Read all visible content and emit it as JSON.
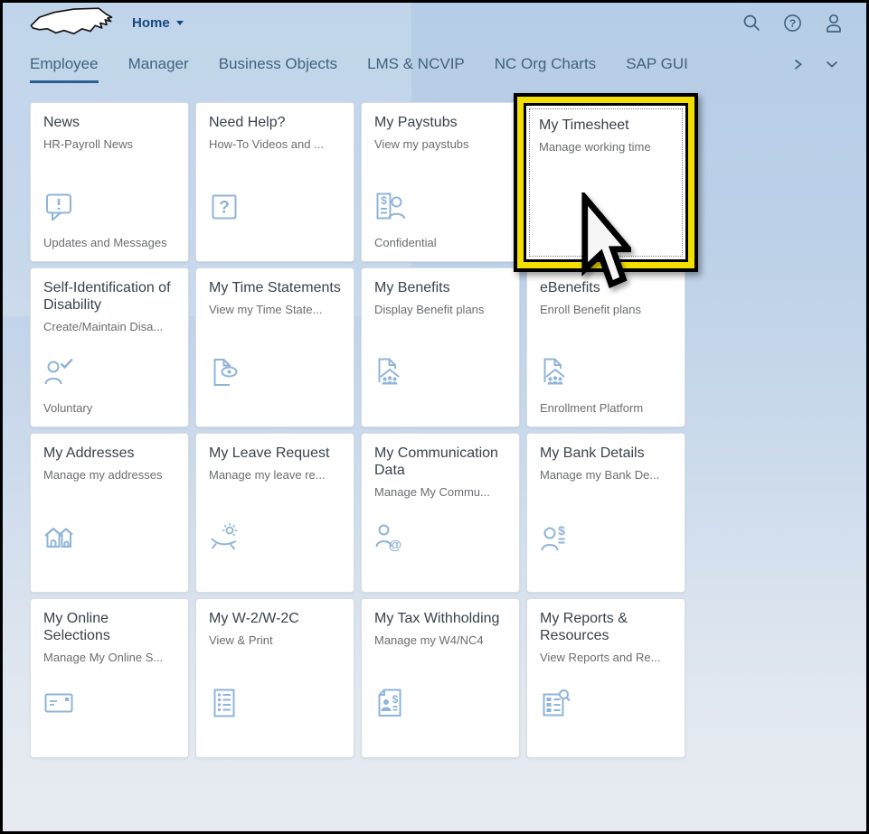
{
  "header": {
    "home_label": "Home",
    "logo": "north-carolina-state-outline",
    "icon_names": [
      "search-icon",
      "help-icon",
      "user-icon"
    ]
  },
  "tabs": [
    {
      "label": "Employee",
      "selected": true
    },
    {
      "label": "Manager",
      "selected": false
    },
    {
      "label": "Business Objects",
      "selected": false
    },
    {
      "label": "LMS & NCVIP",
      "selected": false
    },
    {
      "label": "NC Org Charts",
      "selected": false
    },
    {
      "label": "SAP GUI",
      "selected": false
    }
  ],
  "tiles": [
    {
      "title": "News",
      "subtitle": "HR-Payroll News",
      "footer": "Updates and Messages",
      "icon": "alert-bubble-icon"
    },
    {
      "title": "Need Help?",
      "subtitle": "How-To Videos and ...",
      "footer": "",
      "icon": "question-box-icon"
    },
    {
      "title": "My Paystubs",
      "subtitle": "View my paystubs",
      "footer": "Confidential",
      "icon": "paystub-person-icon"
    },
    {
      "title": "My Timesheet",
      "subtitle": "Manage working time",
      "footer": "",
      "icon": ""
    },
    {
      "title": "Self-Identification of Disability",
      "subtitle": "Create/Maintain Disa...",
      "footer": "Voluntary",
      "icon": "person-check-icon"
    },
    {
      "title": "My Time Statements",
      "subtitle": "View my Time State...",
      "footer": "",
      "icon": "document-eye-icon"
    },
    {
      "title": "My Benefits",
      "subtitle": "Display Benefit plans",
      "footer": "",
      "icon": "family-document-icon"
    },
    {
      "title": "eBenefits",
      "subtitle": "Enroll Benefit plans",
      "footer": "Enrollment Platform",
      "icon": "family-document-icon"
    },
    {
      "title": "My Addresses",
      "subtitle": "Manage my addresses",
      "footer": "",
      "icon": "houses-icon"
    },
    {
      "title": "My Leave Request",
      "subtitle": "Manage my leave re...",
      "footer": "",
      "icon": "vacation-icon"
    },
    {
      "title": "My Communication Data",
      "subtitle": "Manage My Commu...",
      "footer": "",
      "icon": "person-at-icon"
    },
    {
      "title": "My Bank Details",
      "subtitle": "Manage my Bank De...",
      "footer": "",
      "icon": "person-dollar-icon"
    },
    {
      "title": "My Online Selections",
      "subtitle": "Manage My Online S...",
      "footer": "",
      "icon": "envelope-icon"
    },
    {
      "title": "My W-2/W-2C",
      "subtitle": "View & Print",
      "footer": "",
      "icon": "list-document-icon"
    },
    {
      "title": "My Tax Withholding",
      "subtitle": "Manage my W4/NC4",
      "footer": "",
      "icon": "tax-document-icon"
    },
    {
      "title": "My Reports & Resources",
      "subtitle": "View Reports and Re...",
      "footer": "",
      "icon": "report-search-icon"
    }
  ],
  "annotations": {
    "highlight_target": "My Timesheet",
    "cursor": "arrow-pointer"
  },
  "colors": {
    "highlight_yellow": "#f2df00",
    "tab_underline": "#2d5e8e",
    "tile_icon_blue": "#8fb4d9",
    "header_text": "#15477e",
    "tab_text": "#42617f",
    "tile_title": "#39424d",
    "tile_secondary": "#6a6d70"
  }
}
